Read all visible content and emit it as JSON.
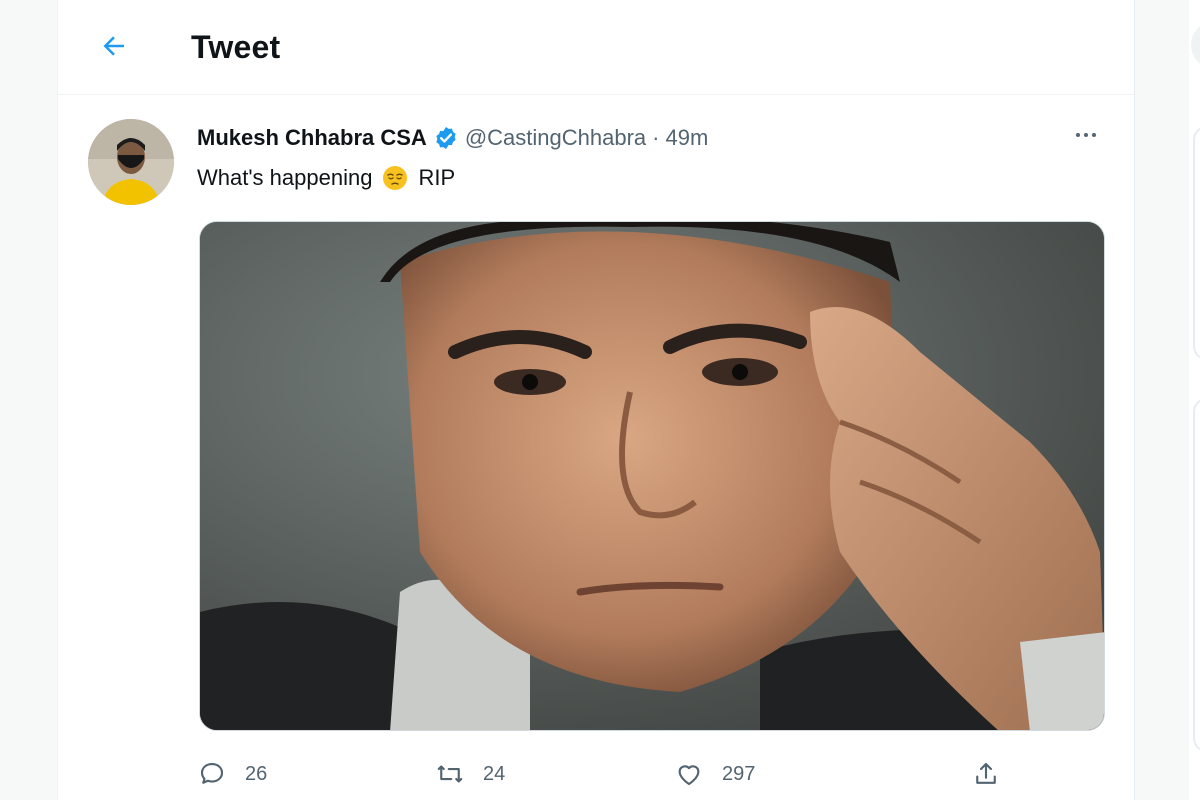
{
  "header": {
    "title": "Tweet",
    "back_icon": "arrow-left-icon"
  },
  "tweet": {
    "author": {
      "display_name": "Mukesh Chhabra CSA",
      "handle": "@CastingChhabra",
      "separator": "·",
      "timestamp": "49m",
      "verified": true
    },
    "text": "What's happening",
    "emoji_icon": "pensive-face-icon",
    "text_suffix": "RIP",
    "media": {
      "description_icon": "photo-icon"
    },
    "actions": {
      "replies": "26",
      "retweets": "24",
      "likes": "297"
    }
  },
  "colors": {
    "accent": "#1d9bf0",
    "muted": "#536471",
    "text": "#0f1419"
  }
}
